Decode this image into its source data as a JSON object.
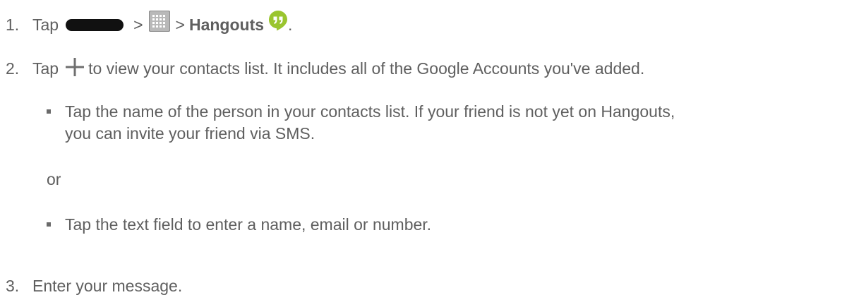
{
  "steps": {
    "s1": {
      "number": "1.",
      "tap": "Tap",
      "sep1": ">",
      "sep2": ">",
      "app_name": "Hangouts",
      "period": ".",
      "icons": [
        "home-key-icon",
        "apps-grid-icon",
        "hangouts-icon"
      ]
    },
    "s2": {
      "number": "2.",
      "tap": "Tap",
      "text": "to view your contacts list. It includes all of the Google Accounts you've added.",
      "icons": [
        "plus-icon"
      ]
    },
    "s3": {
      "number": "3.",
      "text": "Enter your message."
    }
  },
  "bullets": {
    "b1_line1": "Tap the name of the person in your contacts list. If your friend is not yet on Hangouts,",
    "b1_line2": "you can invite your friend via SMS.",
    "or": "or",
    "b2": "Tap the text field to enter a name, email or number."
  },
  "colors": {
    "text": "#5f5f5f",
    "hangouts_green": "#9ac52f",
    "home_key": "#111111"
  }
}
